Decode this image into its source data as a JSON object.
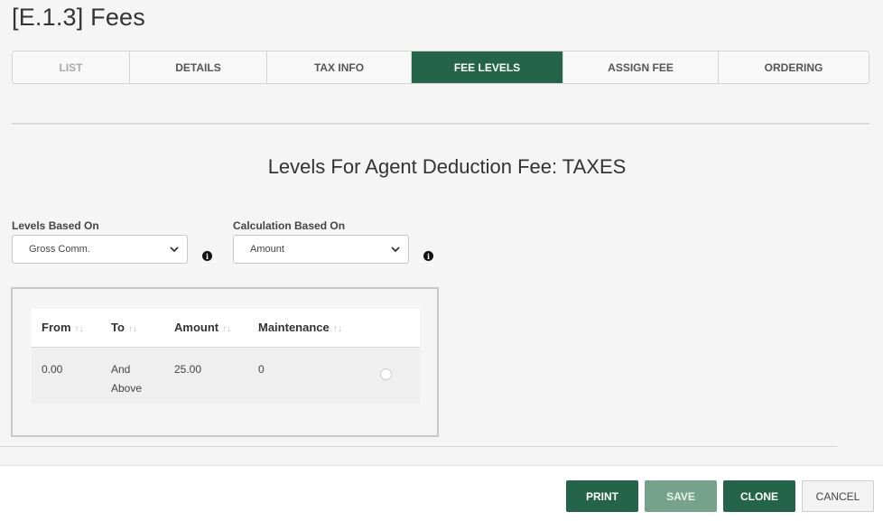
{
  "page": {
    "title": "[E.1.3] Fees"
  },
  "tabs": [
    {
      "label": "LIST",
      "state": "disabled"
    },
    {
      "label": "DETAILS",
      "state": "normal"
    },
    {
      "label": "TAX INFO",
      "state": "normal"
    },
    {
      "label": "FEE LEVELS",
      "state": "active"
    },
    {
      "label": "ASSIGN FEE",
      "state": "normal"
    },
    {
      "label": "ORDERING",
      "state": "normal"
    }
  ],
  "section": {
    "heading": "Levels For Agent Deduction Fee: TAXES"
  },
  "fields": {
    "levels_based_on": {
      "label": "Levels Based On",
      "value": "Gross Comm.",
      "info_icon": "info-icon"
    },
    "calculation_based_on": {
      "label": "Calculation Based On",
      "value": "Amount",
      "info_icon": "info-icon"
    }
  },
  "table": {
    "columns": [
      "From",
      "To",
      "Amount",
      "Maintenance"
    ],
    "sort_glyph": "↑↓",
    "rows": [
      {
        "from": "0.00",
        "to_line1": "And",
        "to_line2": "Above",
        "amount": "25.00",
        "maintenance": "0",
        "selected": false
      }
    ]
  },
  "footer": {
    "buttons": {
      "print": "PRINT",
      "save": "SAVE",
      "clone": "CLONE",
      "cancel": "CANCEL"
    }
  },
  "colors": {
    "accent": "#24644a",
    "accent_muted": "#76a28c",
    "background": "#f5f5f5"
  }
}
